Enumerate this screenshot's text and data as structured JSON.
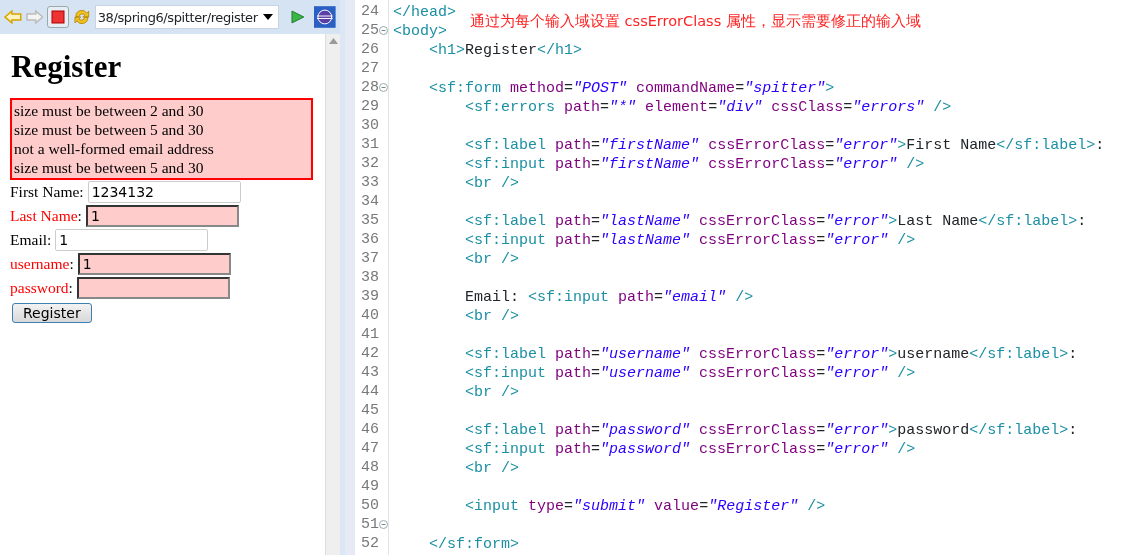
{
  "browser": {
    "address": "38/spring6/spitter/register"
  },
  "page": {
    "heading": "Register",
    "errors": [
      "size must be between 2 and 30",
      "size must be between 5 and 30",
      "not a well-formed email address",
      "size must be between 5 and 30"
    ],
    "fields": [
      {
        "label": "First Name",
        "suffix": ":",
        "value": "1234132",
        "error": false
      },
      {
        "label": "Last Name",
        "suffix": ":",
        "value": "1",
        "error": true
      },
      {
        "label": "Email",
        "suffix": ":",
        "value": "1",
        "error": false
      },
      {
        "label": "username",
        "suffix": ":",
        "value": "1",
        "error": true
      },
      {
        "label": "password",
        "suffix": ":",
        "error": true
      }
    ],
    "submit": "Register"
  },
  "editor": {
    "note": "通过为每个输入域设置 cssErrorClass 属性，显示需要修正的输入域",
    "lines": [
      {
        "number": "24",
        "fold": false,
        "code": "</head>"
      },
      {
        "number": "25",
        "fold": true,
        "code": "<body>"
      },
      {
        "number": "26",
        "fold": false,
        "code": "    <h1>Register</h1>"
      },
      {
        "number": "27",
        "fold": false
      },
      {
        "number": "28",
        "fold": true,
        "code": "    <sf:form method=\"POST\" commandName=\"spitter\">"
      },
      {
        "number": "29",
        "fold": false,
        "code": "        <sf:errors path=\"*\" element=\"div\" cssClass=\"errors\" />"
      },
      {
        "number": "30",
        "fold": false
      },
      {
        "number": "31",
        "fold": false,
        "code": "        <sf:label path=\"firstName\" cssErrorClass=\"error\">First Name</sf:label>:"
      },
      {
        "number": "32",
        "fold": false,
        "code": "        <sf:input path=\"firstName\" cssErrorClass=\"error\" />"
      },
      {
        "number": "33",
        "fold": false,
        "code": "        <br />"
      },
      {
        "number": "34",
        "fold": false
      },
      {
        "number": "35",
        "fold": false,
        "code": "        <sf:label path=\"lastName\" cssErrorClass=\"error\">Last Name</sf:label>:"
      },
      {
        "number": "36",
        "fold": false,
        "code": "        <sf:input path=\"lastName\" cssErrorClass=\"error\" />"
      },
      {
        "number": "37",
        "fold": false,
        "code": "        <br />"
      },
      {
        "number": "38",
        "fold": false
      },
      {
        "number": "39",
        "fold": false,
        "code": "        Email: <sf:input path=\"email\" />"
      },
      {
        "number": "40",
        "fold": false,
        "code": "        <br />"
      },
      {
        "number": "41",
        "fold": false
      },
      {
        "number": "42",
        "fold": false,
        "code": "        <sf:label path=\"username\" cssErrorClass=\"error\">username</sf:label>:"
      },
      {
        "number": "43",
        "fold": false,
        "code": "        <sf:input path=\"username\" cssErrorClass=\"error\" />"
      },
      {
        "number": "44",
        "fold": false,
        "code": "        <br />"
      },
      {
        "number": "45",
        "fold": false
      },
      {
        "number": "46",
        "fold": false,
        "code": "        <sf:label path=\"password\" cssErrorClass=\"error\">password</sf:label>:"
      },
      {
        "number": "47",
        "fold": false,
        "code": "        <sf:input path=\"password\" cssErrorClass=\"error\" />"
      },
      {
        "number": "48",
        "fold": false,
        "code": "        <br />"
      },
      {
        "number": "49",
        "fold": false
      },
      {
        "number": "50",
        "fold": false,
        "code": "        <input type=\"submit\" value=\"Register\" />"
      },
      {
        "number": "51",
        "fold": true
      },
      {
        "number": "52",
        "fold": false,
        "code": "    </sf:form>"
      }
    ]
  }
}
